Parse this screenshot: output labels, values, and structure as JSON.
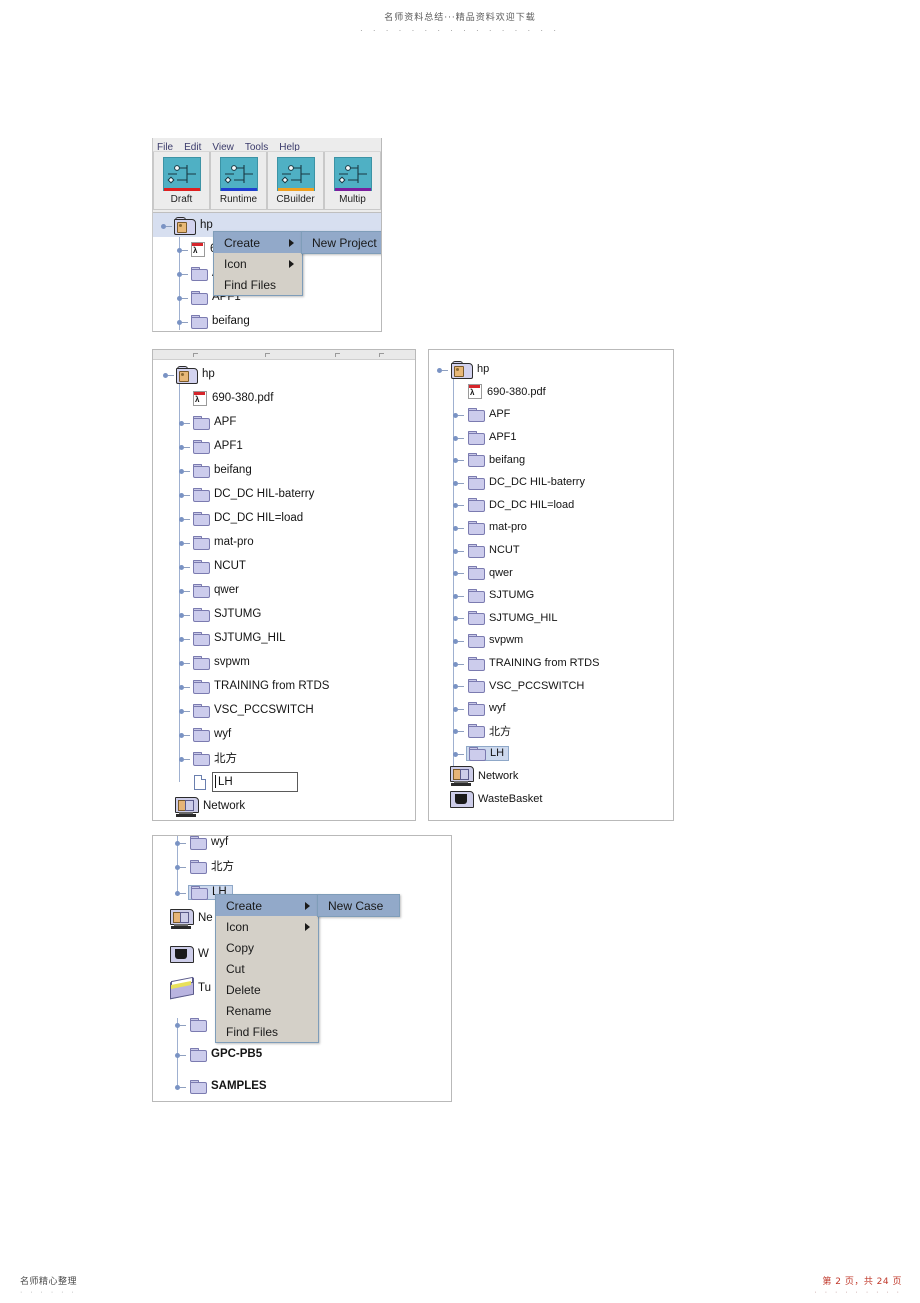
{
  "document": {
    "header_text": "名师资料总结···精品资料欢迎下载",
    "header_dots": "· · · · · · · · · · · · · · · ·",
    "footer_left": "名师精心整理",
    "footer_left_dots": "· · · · · ·",
    "footer_right": "第 2 页，共 24 页",
    "footer_right_dots": "· · · · · · · · ·"
  },
  "panel1": {
    "menubar": [
      {
        "label": "File",
        "mnemonic": "F"
      },
      {
        "label": "Edit",
        "mnemonic": "E"
      },
      {
        "label": "View",
        "mnemonic": "V"
      },
      {
        "label": "Tools",
        "mnemonic": "T"
      },
      {
        "label": "Help",
        "mnemonic": "H"
      }
    ],
    "toolbar": [
      {
        "label": "Draft",
        "accent": "#e02020",
        "icon": "draft-icon"
      },
      {
        "label": "Runtime",
        "accent": "#1f3fd0",
        "icon": "runtime-icon"
      },
      {
        "label": "CBuilder",
        "accent": "#f0a020",
        "icon": "cbuilder-icon"
      },
      {
        "label": "Multip",
        "accent": "#7a1f9e",
        "icon": "multiplot-icon"
      }
    ],
    "tree": [
      {
        "label": "hp",
        "icon": "root-folder-icon",
        "level": 0,
        "selected": true
      },
      {
        "label": "690-380.pdf",
        "icon": "pdf-icon",
        "level": 1
      },
      {
        "label": "APF",
        "icon": "folder-icon",
        "level": 1
      },
      {
        "label": "APF1",
        "icon": "folder-icon",
        "level": 1
      },
      {
        "label": "beifang",
        "icon": "folder-icon",
        "level": 1
      }
    ],
    "context_menu": {
      "items": [
        {
          "label": "Create",
          "has_submenu": true,
          "highlighted": true
        },
        {
          "label": "Icon",
          "has_submenu": true,
          "highlighted": false
        },
        {
          "label": "Find Files",
          "has_submenu": false,
          "highlighted": false
        }
      ],
      "submenu": {
        "items": [
          {
            "label": "New Project",
            "highlighted": true
          }
        ]
      }
    }
  },
  "panel2": {
    "tree": [
      {
        "label": "hp",
        "icon": "root-folder-icon",
        "level": 0,
        "type": "root"
      },
      {
        "label": "690-380.pdf",
        "icon": "pdf-icon",
        "level": 1,
        "type": "pdf"
      },
      {
        "label": "APF",
        "icon": "folder-icon",
        "level": 1,
        "type": "folder"
      },
      {
        "label": "APF1",
        "icon": "folder-icon",
        "level": 1,
        "type": "folder"
      },
      {
        "label": "beifang",
        "icon": "folder-icon",
        "level": 1,
        "type": "folder"
      },
      {
        "label": "DC_DC HIL-baterry",
        "icon": "folder-icon",
        "level": 1,
        "type": "folder"
      },
      {
        "label": "DC_DC HIL=load",
        "icon": "folder-icon",
        "level": 1,
        "type": "folder"
      },
      {
        "label": "mat-pro",
        "icon": "folder-icon",
        "level": 1,
        "type": "folder"
      },
      {
        "label": "NCUT",
        "icon": "folder-icon",
        "level": 1,
        "type": "folder"
      },
      {
        "label": "qwer",
        "icon": "folder-icon",
        "level": 1,
        "type": "folder"
      },
      {
        "label": "SJTUMG",
        "icon": "folder-icon",
        "level": 1,
        "type": "folder"
      },
      {
        "label": "SJTUMG_HIL",
        "icon": "folder-icon",
        "level": 1,
        "type": "folder"
      },
      {
        "label": "svpwm",
        "icon": "folder-icon",
        "level": 1,
        "type": "folder"
      },
      {
        "label": "TRAINING from RTDS",
        "icon": "folder-icon",
        "level": 1,
        "type": "folder"
      },
      {
        "label": "VSC_PCCSWITCH",
        "icon": "folder-icon",
        "level": 1,
        "type": "folder"
      },
      {
        "label": "wyf",
        "icon": "folder-icon",
        "level": 1,
        "type": "folder"
      },
      {
        "label": "北方",
        "icon": "folder-icon",
        "level": 1,
        "type": "folder"
      },
      {
        "label": "",
        "icon": "file-icon",
        "level": 1,
        "type": "rename"
      },
      {
        "label": "Network",
        "icon": "network-icon",
        "level": 0,
        "type": "network"
      }
    ],
    "rename_field": {
      "value": "LH",
      "placeholder": ""
    }
  },
  "panel3": {
    "tree": [
      {
        "label": "hp",
        "icon": "root-folder-icon",
        "level": 0,
        "type": "root"
      },
      {
        "label": "690-380.pdf",
        "icon": "pdf-icon",
        "level": 1,
        "type": "pdf"
      },
      {
        "label": "APF",
        "icon": "folder-icon",
        "level": 1,
        "type": "folder"
      },
      {
        "label": "APF1",
        "icon": "folder-icon",
        "level": 1,
        "type": "folder"
      },
      {
        "label": "beifang",
        "icon": "folder-icon",
        "level": 1,
        "type": "folder"
      },
      {
        "label": "DC_DC HIL-baterry",
        "icon": "folder-icon",
        "level": 1,
        "type": "folder"
      },
      {
        "label": "DC_DC HIL=load",
        "icon": "folder-icon",
        "level": 1,
        "type": "folder"
      },
      {
        "label": "mat-pro",
        "icon": "folder-icon",
        "level": 1,
        "type": "folder"
      },
      {
        "label": "NCUT",
        "icon": "folder-icon",
        "level": 1,
        "type": "folder"
      },
      {
        "label": "qwer",
        "icon": "folder-icon",
        "level": 1,
        "type": "folder"
      },
      {
        "label": "SJTUMG",
        "icon": "folder-icon",
        "level": 1,
        "type": "folder"
      },
      {
        "label": "SJTUMG_HIL",
        "icon": "folder-icon",
        "level": 1,
        "type": "folder"
      },
      {
        "label": "svpwm",
        "icon": "folder-icon",
        "level": 1,
        "type": "folder"
      },
      {
        "label": "TRAINING from RTDS",
        "icon": "folder-icon",
        "level": 1,
        "type": "folder"
      },
      {
        "label": "VSC_PCCSWITCH",
        "icon": "folder-icon",
        "level": 1,
        "type": "folder"
      },
      {
        "label": "wyf",
        "icon": "folder-icon",
        "level": 1,
        "type": "folder"
      },
      {
        "label": "北方",
        "icon": "folder-icon",
        "level": 1,
        "type": "folder"
      },
      {
        "label": "LH",
        "icon": "folder-icon",
        "level": 1,
        "type": "folder",
        "selected": true
      },
      {
        "label": "Network",
        "icon": "network-icon",
        "level": 0,
        "type": "network"
      },
      {
        "label": "WasteBasket",
        "icon": "wastebasket-icon",
        "level": 0,
        "type": "wastebasket"
      }
    ]
  },
  "panel4": {
    "tree": [
      {
        "label": "wyf",
        "icon": "folder-icon",
        "type": "folder",
        "clipped": true
      },
      {
        "label": "北方",
        "icon": "folder-icon",
        "type": "folder"
      },
      {
        "label": "LH",
        "icon": "folder-icon",
        "type": "folder",
        "selected": true
      },
      {
        "label": "Ne",
        "icon": "network-icon",
        "type": "network"
      },
      {
        "label": "W",
        "icon": "wastebasket-icon",
        "type": "wastebasket"
      },
      {
        "label": "Tu",
        "icon": "tutorial-icon",
        "type": "tutorial"
      },
      {
        "label": "",
        "icon": "folder-icon",
        "type": "folder"
      },
      {
        "label": "GPC-PB5",
        "icon": "folder-icon",
        "type": "folder"
      },
      {
        "label": "SAMPLES",
        "icon": "folder-icon",
        "type": "folder"
      }
    ],
    "context_menu": {
      "items": [
        {
          "label": "Create",
          "has_submenu": true,
          "highlighted": true
        },
        {
          "label": "Icon",
          "has_submenu": true,
          "highlighted": false
        },
        {
          "label": "Copy",
          "has_submenu": false,
          "highlighted": false
        },
        {
          "label": "Cut",
          "has_submenu": false,
          "highlighted": false
        },
        {
          "label": "Delete",
          "has_submenu": false,
          "highlighted": false
        },
        {
          "label": "Rename",
          "has_submenu": false,
          "highlighted": false
        },
        {
          "label": "Find Files",
          "has_submenu": false,
          "highlighted": false
        }
      ],
      "submenu": {
        "items": [
          {
            "label": "New Case",
            "highlighted": true
          }
        ]
      }
    }
  }
}
